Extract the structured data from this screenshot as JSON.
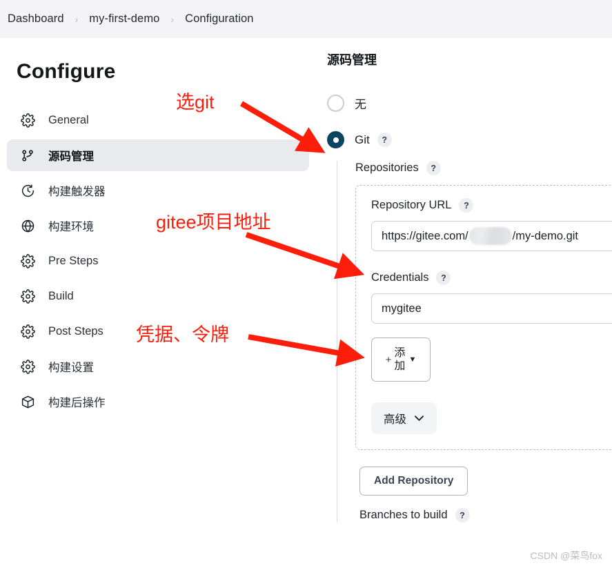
{
  "breadcrumb": {
    "items": [
      "Dashboard",
      "my-first-demo",
      "Configuration"
    ],
    "separator": "›"
  },
  "sidebar": {
    "title": "Configure",
    "items": [
      {
        "label": "General",
        "icon": "gear-icon",
        "selected": false
      },
      {
        "label": "源码管理",
        "icon": "git-branch-icon",
        "selected": true
      },
      {
        "label": "构建触发器",
        "icon": "clock-icon",
        "selected": false
      },
      {
        "label": "构建环境",
        "icon": "globe-icon",
        "selected": false
      },
      {
        "label": "Pre Steps",
        "icon": "gear-icon",
        "selected": false
      },
      {
        "label": "Build",
        "icon": "gear-icon",
        "selected": false
      },
      {
        "label": "Post Steps",
        "icon": "gear-icon",
        "selected": false
      },
      {
        "label": "构建设置",
        "icon": "gear-icon",
        "selected": false
      },
      {
        "label": "构建后操作",
        "icon": "package-icon",
        "selected": false
      }
    ]
  },
  "main": {
    "section_title": "源码管理",
    "scm_options": [
      {
        "label": "无",
        "checked": false,
        "has_help": false
      },
      {
        "label": "Git",
        "checked": true,
        "has_help": true
      }
    ],
    "help_glyph": "?",
    "repositories_label": "Repositories",
    "repository": {
      "url_label": "Repository URL",
      "url_prefix": "https://gitee.com/",
      "url_suffix": "/my-demo.git",
      "url_redacted": true,
      "credentials_label": "Credentials",
      "credentials_value": "mygitee",
      "add_button": {
        "plus": "+",
        "label": "添加",
        "caret": "▼"
      },
      "advanced_button": {
        "label": "高级",
        "caret": "∨"
      }
    },
    "add_repository_label": "Add Repository",
    "branches_label": "Branches to build"
  },
  "annotations": [
    {
      "text": "选git",
      "id": "anno-select-git"
    },
    {
      "text": "gitee项目地址",
      "id": "anno-gitee-url"
    },
    {
      "text": "凭据、令牌",
      "id": "anno-credentials"
    }
  ],
  "watermark": "CSDN @菜鸟fox",
  "colors": {
    "accent_radio": "#0d4460",
    "annotation_red": "#fc1d0b",
    "selected_nav_bg": "#e9eaee",
    "breadcrumb_bg": "#f4f4f6"
  }
}
